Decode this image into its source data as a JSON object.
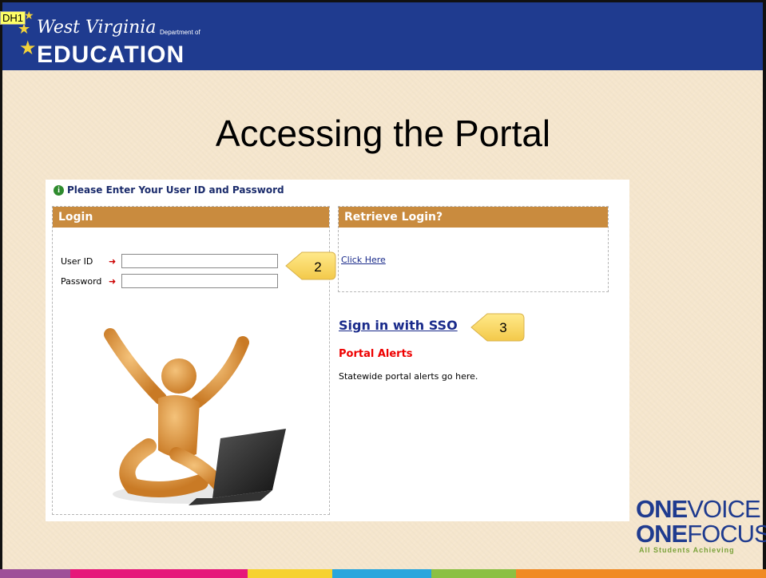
{
  "header": {
    "tag": "DH1",
    "logo_script": "West Virginia",
    "logo_dept": "Department of",
    "logo_main": "EDUCATION"
  },
  "slide_title": "Accessing the Portal",
  "portal": {
    "instruction": "Please Enter Your User ID and Password",
    "login": {
      "header": "Login",
      "user_id_label": "User ID",
      "password_label": "Password",
      "user_id_value": "",
      "password_value": ""
    },
    "retrieve": {
      "header": "Retrieve Login?",
      "link": "Click Here"
    },
    "sso_link": "Sign in with SSO",
    "alerts_title": "Portal Alerts",
    "alerts_text": "Statewide portal alerts go here."
  },
  "callouts": {
    "step2": "2",
    "step3": "3"
  },
  "footer_logo": {
    "line1_bold": "ONE",
    "line1_light": "VOICE",
    "line2_bold": "ONE",
    "line2_light": "FOCUS",
    "tagline": "All Students Achieving"
  },
  "colors": {
    "header_bg": "#1f3b8f",
    "box_header": "#c98b3e",
    "alert_red": "#e00000",
    "bottom_bar": [
      "#9e4f98",
      "#e6177a",
      "#f6d22f",
      "#29a6dd",
      "#8bc043",
      "#f08a24"
    ]
  }
}
